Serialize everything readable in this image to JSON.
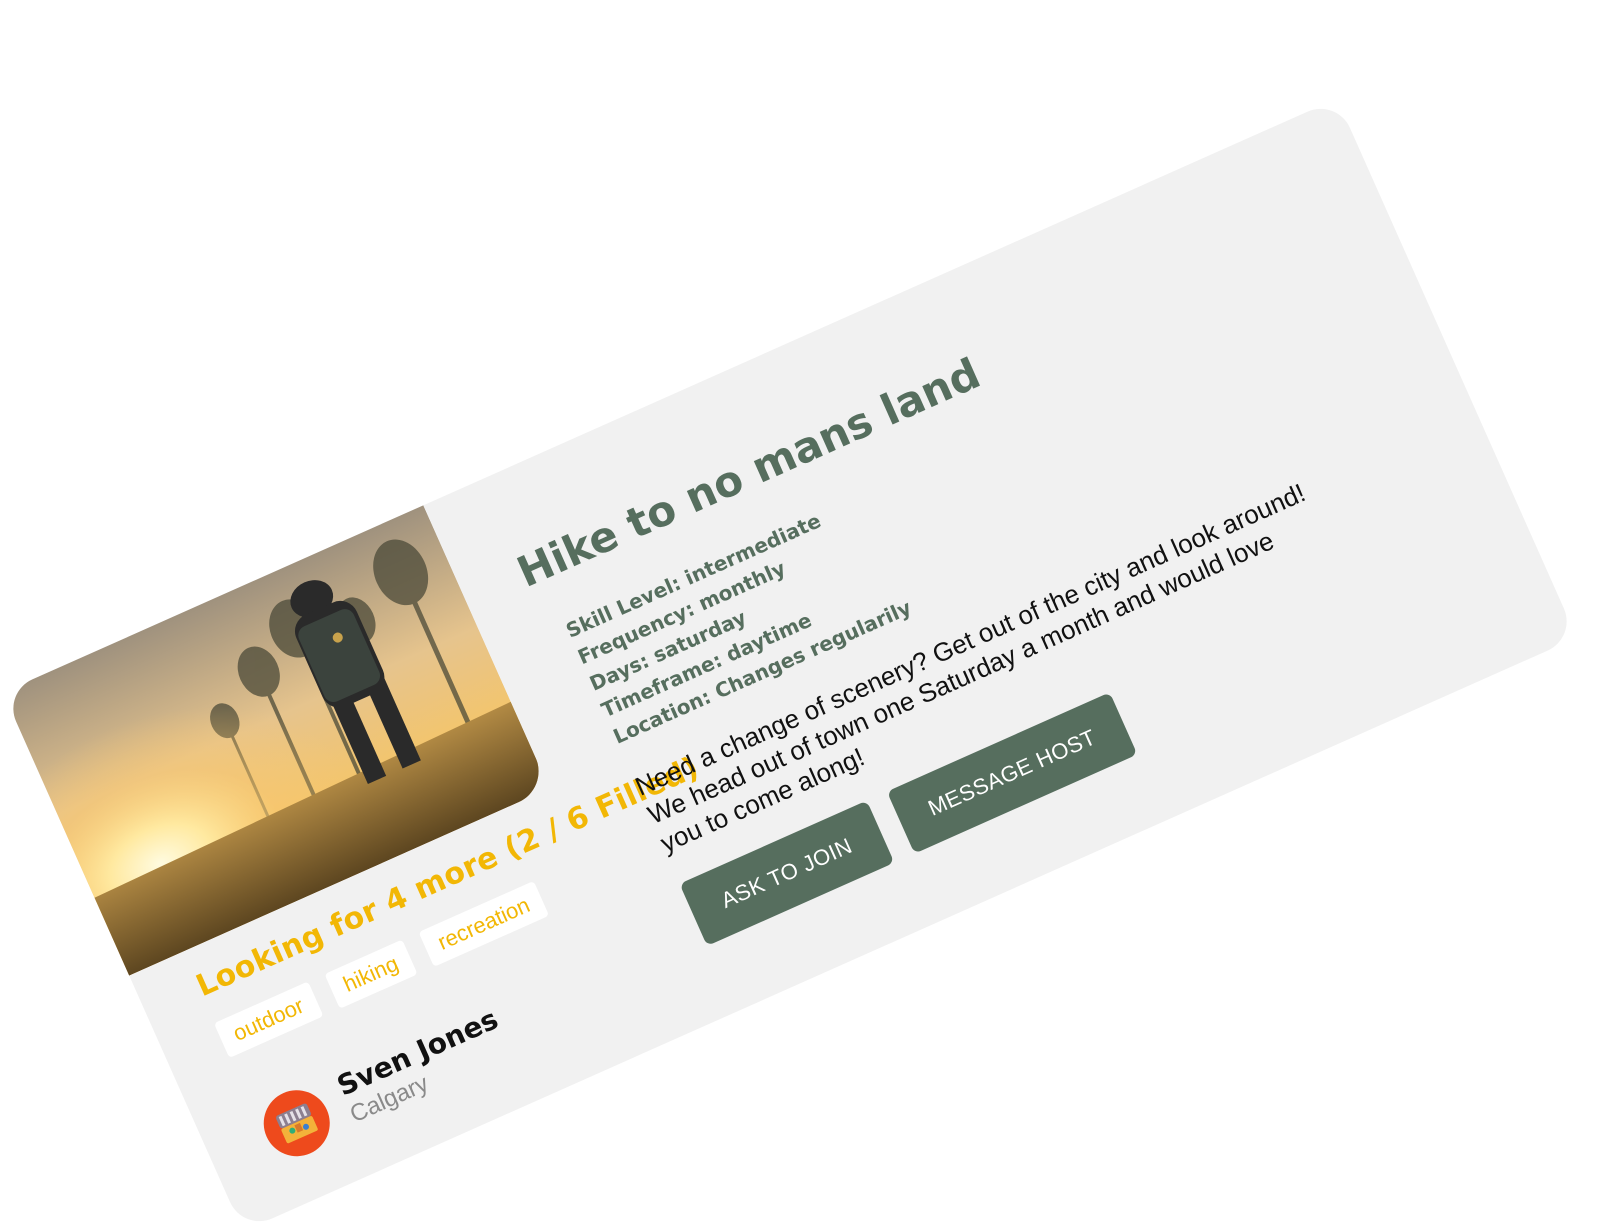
{
  "listing": {
    "title": "Hike to no mans land",
    "image_alt": "Hiker with a large backpack walking toward a sunrise over a misty field",
    "spots": "Looking for 4 more (2 / 6 Filled)",
    "spots_open": 4,
    "spots_filled": 2,
    "spots_total": 6,
    "tags": [
      "outdoor",
      "hiking",
      "recreation"
    ],
    "details": [
      "Skill Level: intermediate",
      "Frequency: monthly",
      "Days: saturday",
      "Timeframe: daytime",
      "Location: Changes regularily"
    ],
    "description": "Need a change of scenery? Get out of the city and look around! We head out of town one Saturday a month and would love you to come along!"
  },
  "host": {
    "name": "Sven Jones",
    "city": "Calgary",
    "avatar_icon": "treasure-chest-icon"
  },
  "actions": {
    "ask_label": "ASK TO JOIN",
    "message_label": "MESSAGE HOST"
  },
  "colors": {
    "card_background": "#f1f1f1",
    "accent_green": "#566e5e",
    "accent_yellow": "#f2b705",
    "avatar_background": "#ee4a1c"
  }
}
